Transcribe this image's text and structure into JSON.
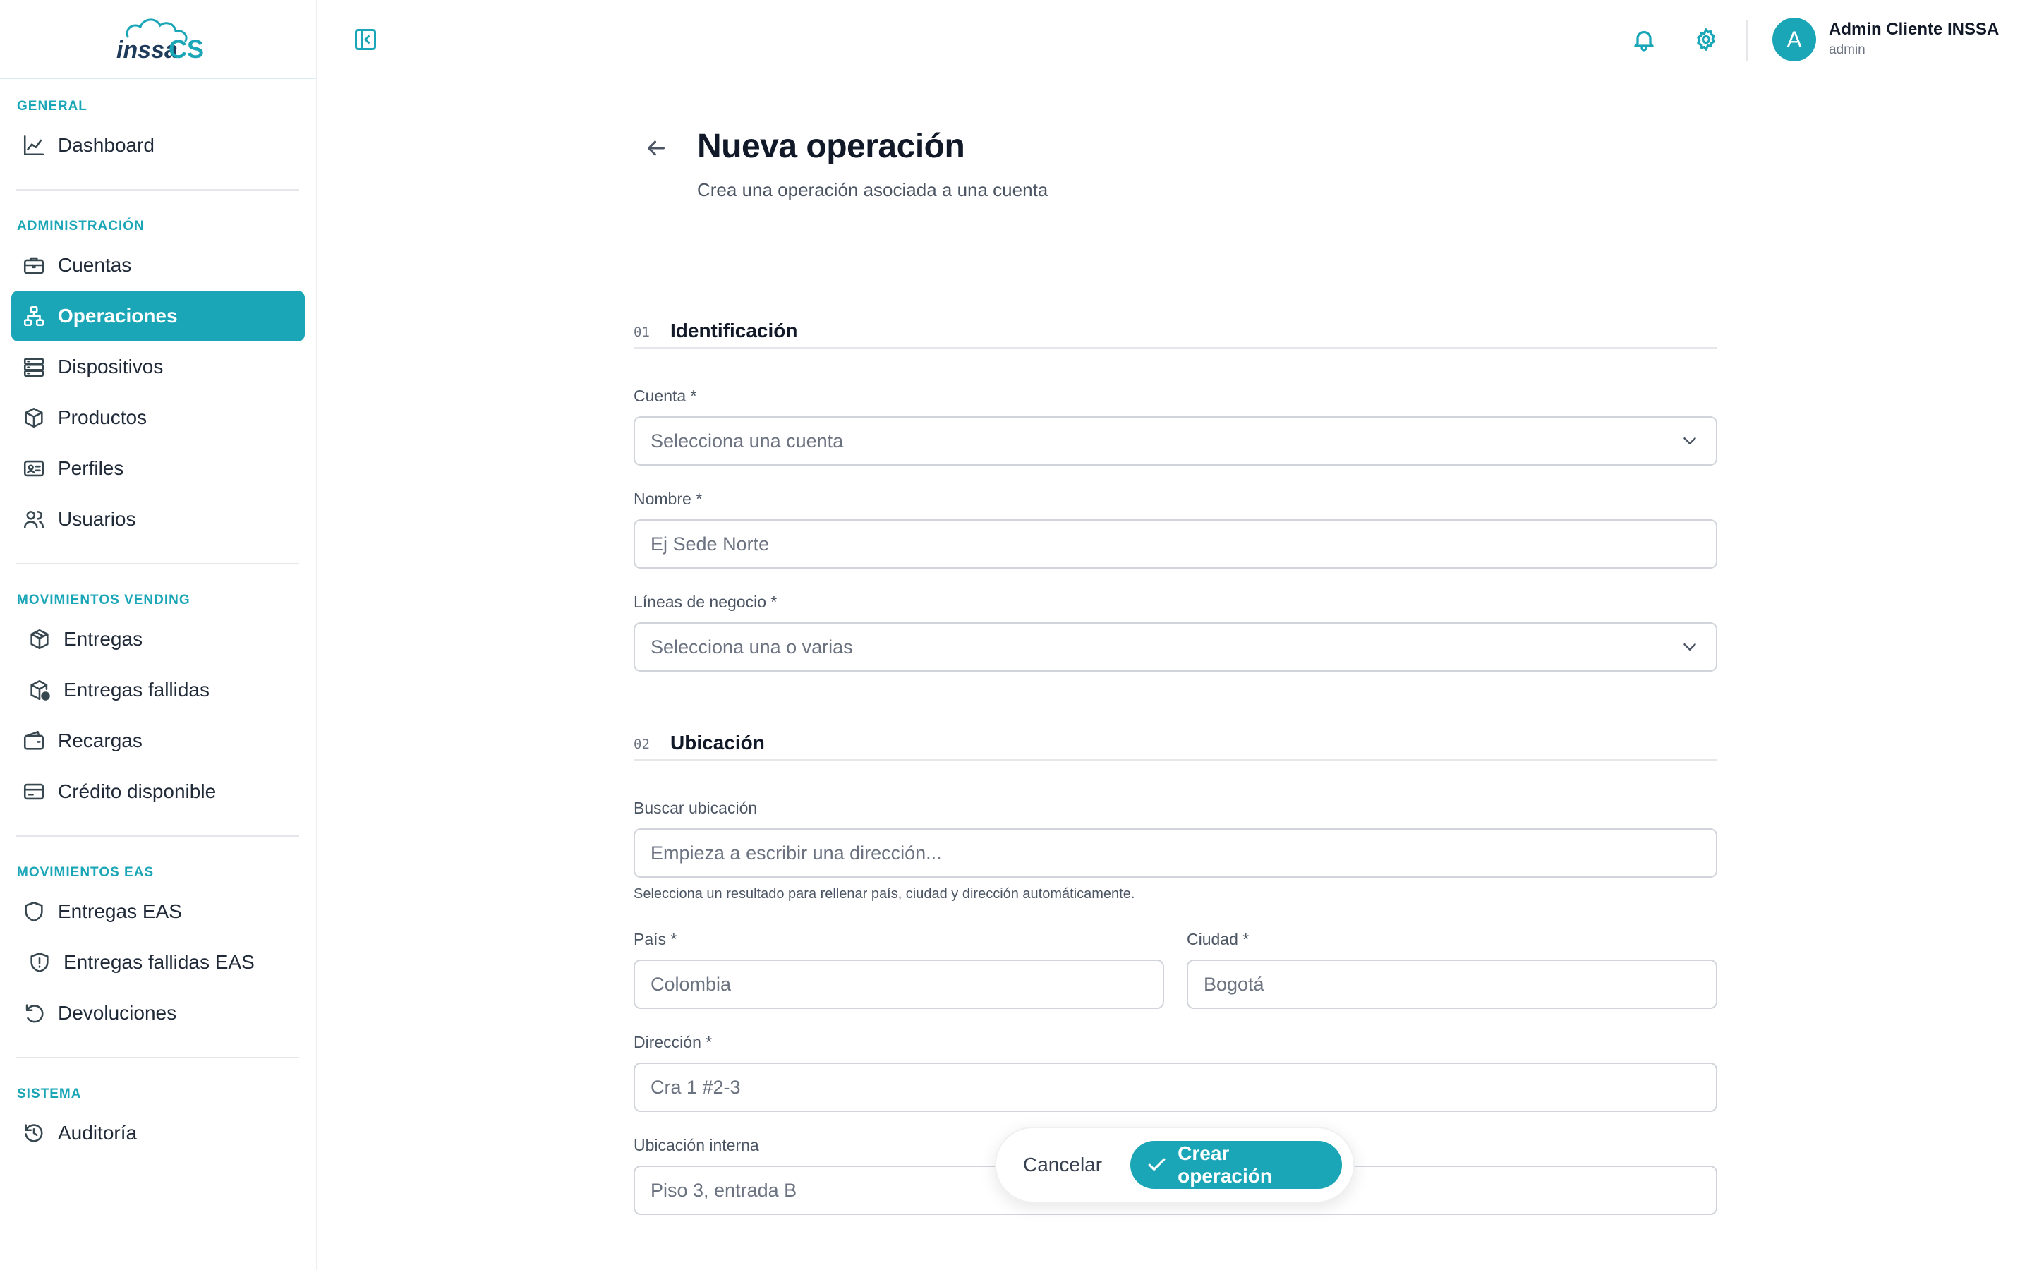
{
  "brand": {
    "logo_text": "inssa CS"
  },
  "sidebar": {
    "sections": [
      {
        "label": "GENERAL",
        "items": [
          {
            "label": "Dashboard",
            "icon": "chart-line-icon"
          }
        ]
      },
      {
        "label": "ADMINISTRACIÓN",
        "items": [
          {
            "label": "Cuentas",
            "icon": "briefcase-icon"
          },
          {
            "label": "Operaciones",
            "icon": "network-icon",
            "active": true
          },
          {
            "label": "Dispositivos",
            "icon": "server-icon"
          },
          {
            "label": "Productos",
            "icon": "box-icon"
          },
          {
            "label": "Perfiles",
            "icon": "id-card-icon"
          },
          {
            "label": "Usuarios",
            "icon": "users-icon"
          }
        ]
      },
      {
        "label": "MOVIMIENTOS VENDING",
        "items": [
          {
            "label": "Entregas",
            "icon": "package-icon"
          },
          {
            "label": "Entregas fallidas",
            "icon": "package-alert-icon"
          },
          {
            "label": "Recargas",
            "icon": "wallet-icon"
          },
          {
            "label": "Crédito disponible",
            "icon": "credit-card-icon"
          }
        ]
      },
      {
        "label": "MOVIMIENTOS EAS",
        "items": [
          {
            "label": "Entregas EAS",
            "icon": "shield-icon"
          },
          {
            "label": "Entregas fallidas EAS",
            "icon": "shield-alert-icon"
          },
          {
            "label": "Devoluciones",
            "icon": "rotate-ccw-icon"
          }
        ]
      },
      {
        "label": "SISTEMA",
        "items": [
          {
            "label": "Auditoría",
            "icon": "history-icon"
          }
        ]
      }
    ]
  },
  "header": {
    "user_initial": "A",
    "user_name": "Admin Cliente INSSA",
    "user_role": "admin"
  },
  "page": {
    "title": "Nueva operación",
    "subtitle": "Crea una operación asociada a una cuenta"
  },
  "form": {
    "section1": {
      "num": "01",
      "title": "Identificación"
    },
    "cuenta": {
      "label": "Cuenta *",
      "placeholder": "Selecciona una cuenta"
    },
    "nombre": {
      "label": "Nombre *",
      "placeholder": "Ej Sede Norte"
    },
    "lineas": {
      "label": "Líneas de negocio *",
      "placeholder": "Selecciona una o varias"
    },
    "section2": {
      "num": "02",
      "title": "Ubicación"
    },
    "buscar": {
      "label": "Buscar ubicación",
      "placeholder": "Empieza a escribir una dirección...",
      "help": "Selecciona un resultado para rellenar país, ciudad y dirección automáticamente."
    },
    "pais": {
      "label": "País *",
      "placeholder": "Colombia"
    },
    "ciudad": {
      "label": "Ciudad *",
      "placeholder": "Bogotá"
    },
    "direccion": {
      "label": "Dirección *",
      "placeholder": "Cra 1 #2-3"
    },
    "interna": {
      "label": "Ubicación interna",
      "placeholder": "Piso 3, entrada B"
    }
  },
  "actions": {
    "cancel": "Cancelar",
    "create": "Crear operación"
  },
  "colors": {
    "accent": "#1aa6b7",
    "text": "#111827",
    "muted": "#6b7280"
  }
}
